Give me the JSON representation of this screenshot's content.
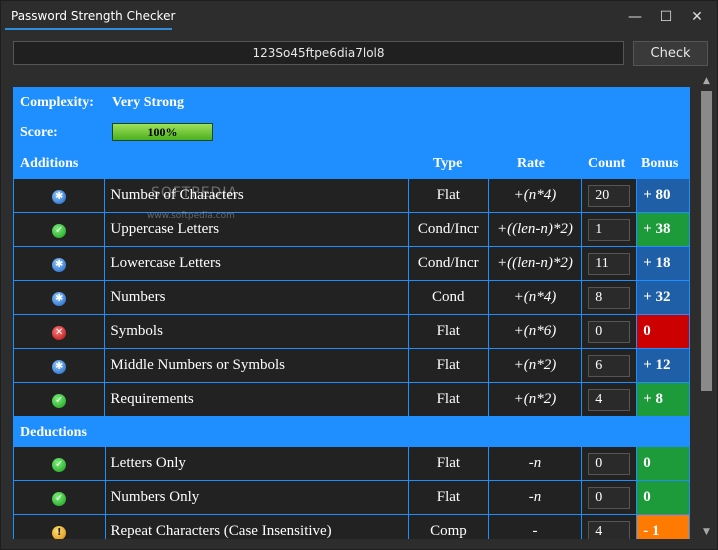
{
  "window": {
    "title": "Password Strength Checker",
    "min_glyph": "—",
    "max_glyph": "☐",
    "close_glyph": "✕"
  },
  "password": {
    "value": "123So45ftpe6dia7lol8"
  },
  "check_button": {
    "label": "Check"
  },
  "summary": {
    "complexity_label": "Complexity:",
    "complexity_value": "Very Strong",
    "score_label": "Score:",
    "score_value": "100%",
    "score_fraction": 1.0
  },
  "additions": {
    "heading": "Additions",
    "col_type": "Type",
    "col_rate": "Rate",
    "col_count": "Count",
    "col_bonus": "Bonus",
    "rows": [
      {
        "icon": "plus-icon",
        "name": "Number of Characters",
        "type": "Flat",
        "rate": "+(n*4)",
        "count": "20",
        "bonus": "+ 80",
        "color": "#1f5fa8"
      },
      {
        "icon": "check-icon",
        "name": "Uppercase Letters",
        "type": "Cond/Incr",
        "rate": "+((len-n)*2)",
        "count": "1",
        "bonus": "+ 38",
        "color": "#1d9a3a"
      },
      {
        "icon": "plus-icon",
        "name": "Lowercase Letters",
        "type": "Cond/Incr",
        "rate": "+((len-n)*2)",
        "count": "11",
        "bonus": "+ 18",
        "color": "#1f5fa8"
      },
      {
        "icon": "plus-icon",
        "name": "Numbers",
        "type": "Cond",
        "rate": "+(n*4)",
        "count": "8",
        "bonus": "+ 32",
        "color": "#1f5fa8"
      },
      {
        "icon": "x-icon",
        "name": "Symbols",
        "type": "Flat",
        "rate": "+(n*6)",
        "count": "0",
        "bonus": "0",
        "color": "#cc0000"
      },
      {
        "icon": "plus-icon",
        "name": "Middle Numbers or Symbols",
        "type": "Flat",
        "rate": "+(n*2)",
        "count": "6",
        "bonus": "+ 12",
        "color": "#1f5fa8"
      },
      {
        "icon": "check-icon",
        "name": "Requirements",
        "type": "Flat",
        "rate": "+(n*2)",
        "count": "4",
        "bonus": "+ 8",
        "color": "#1d9a3a"
      }
    ]
  },
  "deductions": {
    "heading": "Deductions",
    "rows": [
      {
        "icon": "check-icon",
        "name": "Letters Only",
        "type": "Flat",
        "rate": "-n",
        "count": "0",
        "bonus": "0",
        "color": "#1d9a3a"
      },
      {
        "icon": "check-icon",
        "name": "Numbers Only",
        "type": "Flat",
        "rate": "-n",
        "count": "0",
        "bonus": "0",
        "color": "#1d9a3a"
      },
      {
        "icon": "warning-icon",
        "name": "Repeat Characters (Case Insensitive)",
        "type": "Comp",
        "rate": "-",
        "count": "4",
        "bonus": "- 1",
        "color": "#ff7a00"
      }
    ]
  },
  "watermark": {
    "line1": "SOFTPEDIA",
    "line2": "www.softpedia.com"
  }
}
